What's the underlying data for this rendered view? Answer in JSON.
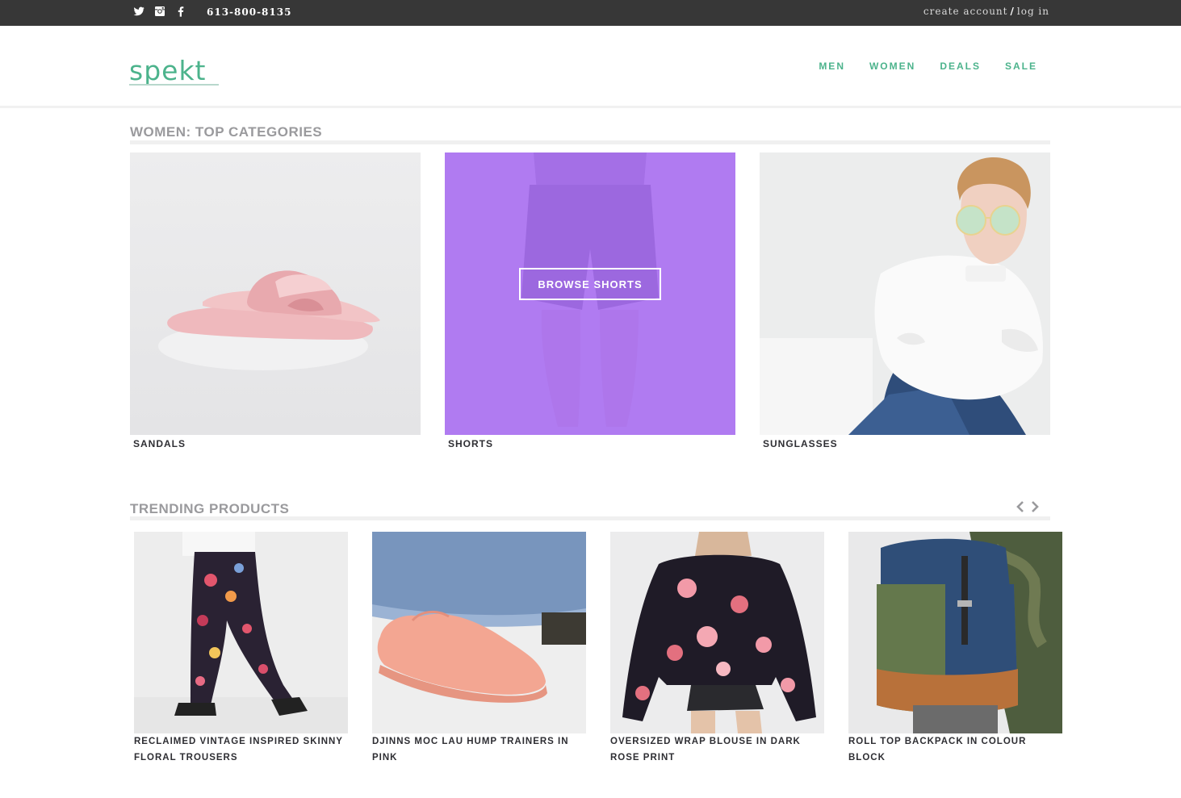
{
  "topbar": {
    "phone": "613-800-8135",
    "create_account": "create account",
    "separator": "/",
    "log_in": "log in",
    "social": [
      "twitter-icon",
      "instagram-icon",
      "facebook-icon"
    ]
  },
  "header": {
    "logo_text": "spekt",
    "nav": [
      "MEN",
      "WOMEN",
      "DEALS",
      "SALE"
    ]
  },
  "categories": {
    "title": "WOMEN: TOP CATEGORIES",
    "items": [
      {
        "label": "SANDALS"
      },
      {
        "label": "SHORTS",
        "button": "BROWSE SHORTS"
      },
      {
        "label": "SUNGLASSES"
      }
    ]
  },
  "trending": {
    "title": "TRENDING PRODUCTS",
    "products": [
      {
        "label": "RECLAIMED VINTAGE INSPIRED SKINNY FLORAL TROUSERS"
      },
      {
        "label": "DJINNS MOC LAU HUMP TRAINERS IN PINK"
      },
      {
        "label": "OVERSIZED WRAP BLOUSE IN DARK ROSE PRINT"
      },
      {
        "label": "ROLL TOP BACKPACK IN COLOUR BLOCK"
      }
    ]
  },
  "colors": {
    "accent": "#4cb38c",
    "topbar": "#373737",
    "overlay": "#aa6ef5",
    "title_gray": "#9a9a9d"
  }
}
